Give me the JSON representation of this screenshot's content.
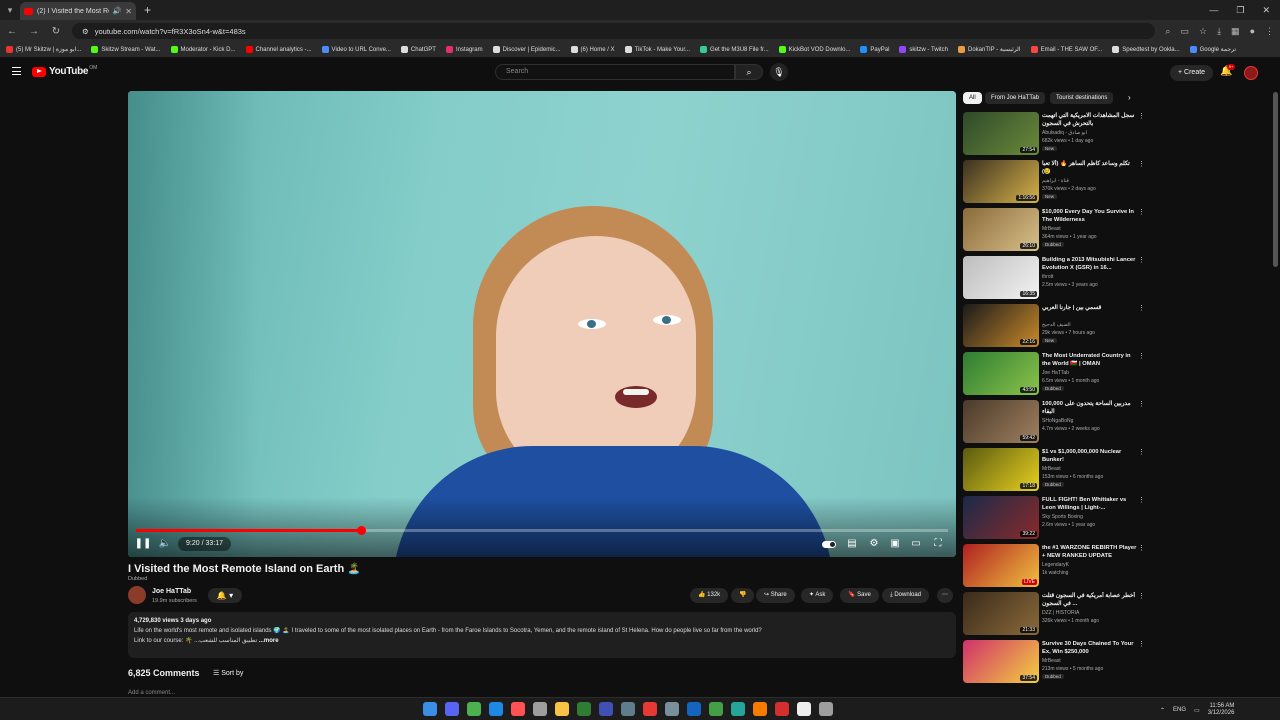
{
  "browser": {
    "tab_title": "(2) I Visited the Most Rem",
    "url": "youtube.com/watch?v=fR3X3oSn4-w&t=483s",
    "bookmarks": [
      {
        "label": "(5) Mr Skitzw | ابو موزة...",
        "color": "#e33"
      },
      {
        "label": "Skitzw Stream - Wat...",
        "color": "#53fc18"
      },
      {
        "label": "Moderator - Kick D...",
        "color": "#53fc18"
      },
      {
        "label": "Channel analytics -...",
        "color": "#f00"
      },
      {
        "label": "Video to URL Conve...",
        "color": "#4a8cff"
      },
      {
        "label": "ChatGPT",
        "color": "#ddd"
      },
      {
        "label": "Instagram",
        "color": "#e1306c"
      },
      {
        "label": "Discover | Epidemic...",
        "color": "#ddd"
      },
      {
        "label": "(6) Home / X",
        "color": "#ddd"
      },
      {
        "label": "TikTok - Make Your...",
        "color": "#ddd"
      },
      {
        "label": "Get the M3U8 File fr...",
        "color": "#3c9"
      },
      {
        "label": "KickBot VOD Downlo...",
        "color": "#53fc18"
      },
      {
        "label": "PayPal",
        "color": "#1e90ff"
      },
      {
        "label": "skitzw - Twitch",
        "color": "#9146ff"
      },
      {
        "label": "DokanTIP - الرئيسية",
        "color": "#e94"
      },
      {
        "label": "Email - THE SAW OF...",
        "color": "#f44"
      },
      {
        "label": "Speedtest by Ookla...",
        "color": "#ddd"
      },
      {
        "label": "Google ترجمة",
        "color": "#4a8cff"
      }
    ]
  },
  "header": {
    "logo_text": "YouTube",
    "region": "OM",
    "search_placeholder": "Search",
    "create_label": "Create",
    "notif_count": "9+"
  },
  "player": {
    "progress": 0.277,
    "time_text": "9:20 / 33:17"
  },
  "video": {
    "title": "I Visited the Most Remote Island on Earth 🏝️",
    "dubbed": "Dubbed",
    "channel": "Joe HaTTab",
    "subscribers": "19.9m subscribers",
    "likes": "132k",
    "share_label": "Share",
    "ask_label": "Ask",
    "save_label": "Save",
    "download_label": "Download",
    "stats": "4,729,830 views  3 days ago",
    "description": "Life on the world's most remote and isolated islands 🌍 🏝️ I traveled to some of the most isolated places on Earth - from the Faroe Islands to Socotra, Yemen, and the remote island of St Helena. How do people live so far from the world?",
    "link_line": "Link to our course:  🌴 ...تطبيق المناسب للشعب",
    "more": "...more",
    "comments_count": "6,825 Comments",
    "sort_label": "Sort by",
    "add_comment": "Add a comment..."
  },
  "chips": [
    "All",
    "From Joe HaTTab",
    "Tourist destinations"
  ],
  "recommendations": [
    {
      "title": "سجل المشاهدات الامريكية التي اتهمت بالتحرش في السجون",
      "channel": "Abulsadiq - ابو صادق",
      "meta": "682k views • 1 day ago",
      "badge": "New",
      "duration": "27:54",
      "c1": "#2d4a2a",
      "c2": "#6b8a3a"
    },
    {
      "title": "تكلم وساعد كاظم الساهر 🔥 (ألا تعبا 😢)",
      "channel": "قناة - ابراهيم",
      "meta": "370k views • 2 days ago",
      "badge": "New",
      "duration": "1:16:56",
      "c1": "#3a3020",
      "c2": "#d6b24a"
    },
    {
      "title": "$10,000 Every Day You Survive In The Wilderness",
      "channel": "MrBeast",
      "meta": "364m views • 1 year ago",
      "badge": "Dubbed",
      "duration": "26:10",
      "c1": "#8a6a3a",
      "c2": "#d8c08a"
    },
    {
      "title": "Building a 2013 Mitsubishi Lancer Evolution X (GSR) in 16...",
      "channel": "thrott",
      "meta": "2.5m views • 3 years ago",
      "badge": "",
      "duration": "16:35",
      "c1": "#bdbdbd",
      "c2": "#f2f2f2"
    },
    {
      "title": "قسمي بين | جارنا العربي",
      "channel": "الضيف الدحيح",
      "meta": "29k views • 7 hours ago",
      "badge": "New",
      "duration": "22:16",
      "c1": "#1a1a1a",
      "c2": "#c98a2a"
    },
    {
      "title": "The Most Underrated Country in the World 🇴🇲 | OMAN",
      "channel": "Joe HaTTab",
      "meta": "6.5m views • 1 month ago",
      "badge": "Dubbed",
      "duration": "43:50",
      "c1": "#2e7d32",
      "c2": "#8bc34a"
    },
    {
      "title": "100,000 مدربين الساحة يتحدون على البقاء",
      "channel": "SHoNgaBoNg",
      "meta": "4.7m views • 2 weeks ago",
      "badge": "",
      "duration": "59:42",
      "c1": "#4a3a2a",
      "c2": "#a08060"
    },
    {
      "title": "$1 vs $1,000,000,000 Nuclear Bunker!",
      "channel": "MrBeast",
      "meta": "153m views • 6 months ago",
      "badge": "Dubbed",
      "duration": "17:18",
      "c1": "#5a5a10",
      "c2": "#e8d020"
    },
    {
      "title": "FULL FIGHT! Ben Whittaker vs Leon Willings | Light-...",
      "channel": "Sky Sports Boxing",
      "meta": "2.6m views • 1 year ago",
      "badge": "",
      "duration": "39:22",
      "c1": "#1a2a4a",
      "c2": "#8a2a2a"
    },
    {
      "title": "the #1 WARZONE REBIRTH Player + NEW RANKED UPDATE",
      "channel": "LegendaryK",
      "meta": "1k watching",
      "badge": "",
      "duration": "LIVE",
      "c1": "#b02020",
      "c2": "#f0c040"
    },
    {
      "title": "أخطر عصابة أمريكية في السجون قتلت ... في السجون",
      "channel": "DZZ | HISTORIA",
      "meta": "326k views • 1 month ago",
      "badge": "",
      "duration": "21:33",
      "c1": "#3a2a1a",
      "c2": "#8a6a3a"
    },
    {
      "title": "Survive 30 Days Chained To Your Ex, Win $250,000",
      "channel": "MrBeast",
      "meta": "213m views • 5 months ago",
      "badge": "Dubbed",
      "duration": "37:54",
      "c1": "#d0306a",
      "c2": "#f4d040"
    }
  ],
  "taskbar": {
    "lang": "ENG",
    "time": "11:56 AM",
    "date": "3/12/2026"
  }
}
